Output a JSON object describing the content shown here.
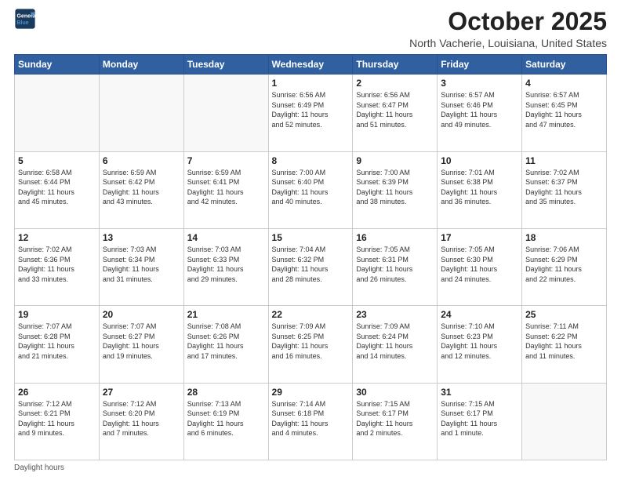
{
  "header": {
    "logo_line1": "General",
    "logo_line2": "Blue",
    "month": "October 2025",
    "location": "North Vacherie, Louisiana, United States"
  },
  "weekdays": [
    "Sunday",
    "Monday",
    "Tuesday",
    "Wednesday",
    "Thursday",
    "Friday",
    "Saturday"
  ],
  "weeks": [
    [
      {
        "day": "",
        "info": ""
      },
      {
        "day": "",
        "info": ""
      },
      {
        "day": "",
        "info": ""
      },
      {
        "day": "1",
        "info": "Sunrise: 6:56 AM\nSunset: 6:49 PM\nDaylight: 11 hours\nand 52 minutes."
      },
      {
        "day": "2",
        "info": "Sunrise: 6:56 AM\nSunset: 6:47 PM\nDaylight: 11 hours\nand 51 minutes."
      },
      {
        "day": "3",
        "info": "Sunrise: 6:57 AM\nSunset: 6:46 PM\nDaylight: 11 hours\nand 49 minutes."
      },
      {
        "day": "4",
        "info": "Sunrise: 6:57 AM\nSunset: 6:45 PM\nDaylight: 11 hours\nand 47 minutes."
      }
    ],
    [
      {
        "day": "5",
        "info": "Sunrise: 6:58 AM\nSunset: 6:44 PM\nDaylight: 11 hours\nand 45 minutes."
      },
      {
        "day": "6",
        "info": "Sunrise: 6:59 AM\nSunset: 6:42 PM\nDaylight: 11 hours\nand 43 minutes."
      },
      {
        "day": "7",
        "info": "Sunrise: 6:59 AM\nSunset: 6:41 PM\nDaylight: 11 hours\nand 42 minutes."
      },
      {
        "day": "8",
        "info": "Sunrise: 7:00 AM\nSunset: 6:40 PM\nDaylight: 11 hours\nand 40 minutes."
      },
      {
        "day": "9",
        "info": "Sunrise: 7:00 AM\nSunset: 6:39 PM\nDaylight: 11 hours\nand 38 minutes."
      },
      {
        "day": "10",
        "info": "Sunrise: 7:01 AM\nSunset: 6:38 PM\nDaylight: 11 hours\nand 36 minutes."
      },
      {
        "day": "11",
        "info": "Sunrise: 7:02 AM\nSunset: 6:37 PM\nDaylight: 11 hours\nand 35 minutes."
      }
    ],
    [
      {
        "day": "12",
        "info": "Sunrise: 7:02 AM\nSunset: 6:36 PM\nDaylight: 11 hours\nand 33 minutes."
      },
      {
        "day": "13",
        "info": "Sunrise: 7:03 AM\nSunset: 6:34 PM\nDaylight: 11 hours\nand 31 minutes."
      },
      {
        "day": "14",
        "info": "Sunrise: 7:03 AM\nSunset: 6:33 PM\nDaylight: 11 hours\nand 29 minutes."
      },
      {
        "day": "15",
        "info": "Sunrise: 7:04 AM\nSunset: 6:32 PM\nDaylight: 11 hours\nand 28 minutes."
      },
      {
        "day": "16",
        "info": "Sunrise: 7:05 AM\nSunset: 6:31 PM\nDaylight: 11 hours\nand 26 minutes."
      },
      {
        "day": "17",
        "info": "Sunrise: 7:05 AM\nSunset: 6:30 PM\nDaylight: 11 hours\nand 24 minutes."
      },
      {
        "day": "18",
        "info": "Sunrise: 7:06 AM\nSunset: 6:29 PM\nDaylight: 11 hours\nand 22 minutes."
      }
    ],
    [
      {
        "day": "19",
        "info": "Sunrise: 7:07 AM\nSunset: 6:28 PM\nDaylight: 11 hours\nand 21 minutes."
      },
      {
        "day": "20",
        "info": "Sunrise: 7:07 AM\nSunset: 6:27 PM\nDaylight: 11 hours\nand 19 minutes."
      },
      {
        "day": "21",
        "info": "Sunrise: 7:08 AM\nSunset: 6:26 PM\nDaylight: 11 hours\nand 17 minutes."
      },
      {
        "day": "22",
        "info": "Sunrise: 7:09 AM\nSunset: 6:25 PM\nDaylight: 11 hours\nand 16 minutes."
      },
      {
        "day": "23",
        "info": "Sunrise: 7:09 AM\nSunset: 6:24 PM\nDaylight: 11 hours\nand 14 minutes."
      },
      {
        "day": "24",
        "info": "Sunrise: 7:10 AM\nSunset: 6:23 PM\nDaylight: 11 hours\nand 12 minutes."
      },
      {
        "day": "25",
        "info": "Sunrise: 7:11 AM\nSunset: 6:22 PM\nDaylight: 11 hours\nand 11 minutes."
      }
    ],
    [
      {
        "day": "26",
        "info": "Sunrise: 7:12 AM\nSunset: 6:21 PM\nDaylight: 11 hours\nand 9 minutes."
      },
      {
        "day": "27",
        "info": "Sunrise: 7:12 AM\nSunset: 6:20 PM\nDaylight: 11 hours\nand 7 minutes."
      },
      {
        "day": "28",
        "info": "Sunrise: 7:13 AM\nSunset: 6:19 PM\nDaylight: 11 hours\nand 6 minutes."
      },
      {
        "day": "29",
        "info": "Sunrise: 7:14 AM\nSunset: 6:18 PM\nDaylight: 11 hours\nand 4 minutes."
      },
      {
        "day": "30",
        "info": "Sunrise: 7:15 AM\nSunset: 6:17 PM\nDaylight: 11 hours\nand 2 minutes."
      },
      {
        "day": "31",
        "info": "Sunrise: 7:15 AM\nSunset: 6:17 PM\nDaylight: 11 hours\nand 1 minute."
      },
      {
        "day": "",
        "info": ""
      }
    ]
  ],
  "footer": {
    "note": "Daylight hours"
  }
}
